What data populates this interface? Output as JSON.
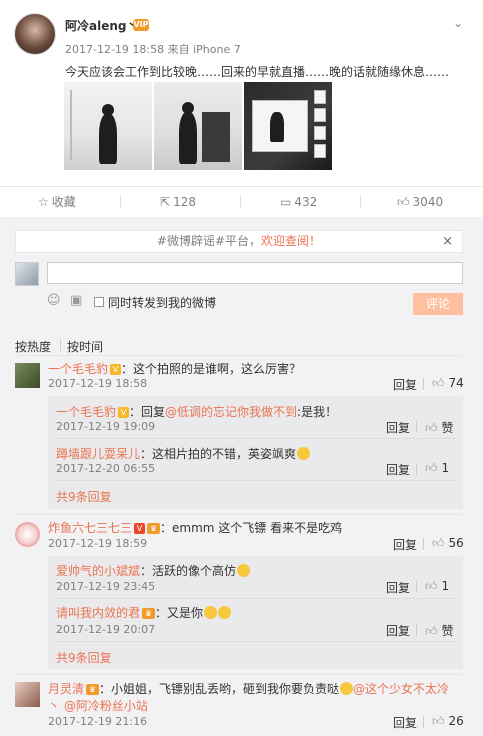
{
  "post": {
    "author": "阿冷aleng丶",
    "author_badge": "VIP",
    "menu_icon": "chevron-down-icon",
    "meta": "2017-12-19 18:58 来自 iPhone 7",
    "content": "今天应该会工作到比较晚……回来的早就直播……晚的话就随缘休息……"
  },
  "actions": {
    "favorite": "收藏",
    "forward": "128",
    "comment": "432",
    "like": "3040"
  },
  "notice": {
    "prefix": "#微博辟谣#平台，",
    "highlight": "欢迎查阅！",
    "close": "×"
  },
  "composer": {
    "input_value": "",
    "forward_label": "同时转发到我的微博",
    "submit": "评论"
  },
  "sort": {
    "hot": "按热度",
    "time": "按时间"
  },
  "comments": [
    {
      "name": "一个毛毛豹",
      "text": "：这个拍照的是谁啊，这么厉害？",
      "time": "2017-12-19 18:58",
      "reply": "回复",
      "likes": "74",
      "replies": [
        {
          "name": "一个毛毛豹",
          "pre": "：回复",
          "at": "@低调的忘记你我做不到",
          "post": ":是我！",
          "time": "2017-12-19 19:09",
          "reply": "回复",
          "likes": "赞"
        },
        {
          "name": "蹲墙跟儿耍呆儿",
          "pre": "：这相片拍的不错，英姿飒爽",
          "at": "",
          "post": "",
          "time": "2017-12-20 06:55",
          "reply": "回复",
          "likes": "1"
        }
      ],
      "more": "共9条回复"
    },
    {
      "name": "炸鱼六七三七三",
      "text": "：emmm 这个飞镖 看来不是吃鸡",
      "time": "2017-12-19 18:59",
      "reply": "回复",
      "likes": "56",
      "replies": [
        {
          "name": "爱帅气的小斌斌",
          "pre": "：活跃的像个高仿",
          "at": "",
          "post": "",
          "time": "2017-12-19 23:45",
          "reply": "回复",
          "likes": "1"
        },
        {
          "name": "请叫我内敛的君",
          "pre": "：又是你",
          "at": "",
          "post": "",
          "time": "2017-12-19 20:07",
          "reply": "回复",
          "likes": "赞"
        }
      ],
      "more": "共9条回复"
    },
    {
      "name": "月灵清",
      "text": "：小姐姐，飞镖别乱丢哟，砸到我你要负责哒",
      "at1": "@这个少女不太冷",
      "line2_pre": "丶",
      "at2": "@阿冷粉丝小站",
      "time": "2017-12-19 21:16",
      "reply": "回复",
      "likes": "26"
    }
  ]
}
